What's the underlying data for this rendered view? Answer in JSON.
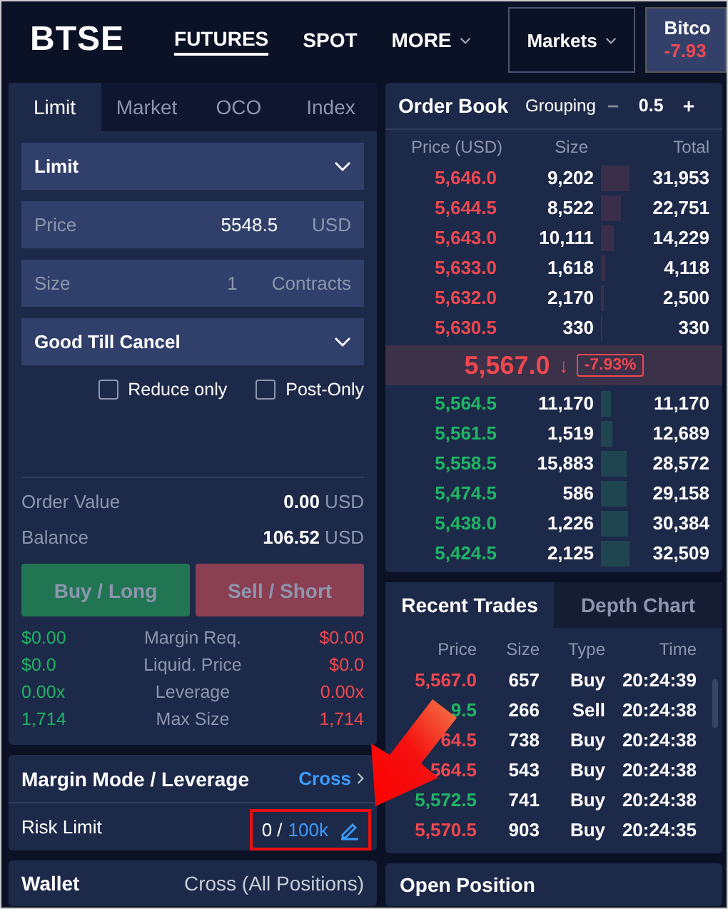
{
  "header": {
    "logo": "BTSE",
    "nav": [
      {
        "label": "FUTURES",
        "selected": true,
        "dropdown": false
      },
      {
        "label": "SPOT",
        "selected": false,
        "dropdown": false
      },
      {
        "label": "MORE",
        "selected": false,
        "dropdown": true
      }
    ],
    "markets_button": "Markets",
    "ticker": {
      "name": "Bitco",
      "change": "-7.93"
    }
  },
  "order_form": {
    "tabs": [
      {
        "label": "Limit",
        "selected": true
      },
      {
        "label": "Market",
        "selected": false
      },
      {
        "label": "OCO",
        "selected": false
      },
      {
        "label": "Index",
        "selected": false
      }
    ],
    "order_type": "Limit",
    "price": {
      "label": "Price",
      "value": "5548.5",
      "unit": "USD"
    },
    "size": {
      "label": "Size",
      "value": "1",
      "unit": "Contracts"
    },
    "time_in_force": "Good Till Cancel",
    "options": [
      {
        "label": "Reduce only",
        "checked": false
      },
      {
        "label": "Post-Only",
        "checked": false
      }
    ],
    "summary": [
      {
        "label": "Order Value",
        "value": "0.00",
        "unit": "USD"
      },
      {
        "label": "Balance",
        "value": "106.52",
        "unit": "USD"
      }
    ],
    "buy_button": "Buy / Long",
    "sell_button": "Sell / Short",
    "stats": [
      {
        "buy": "$0.00",
        "label": "Margin Req.",
        "sell": "$0.00"
      },
      {
        "buy": "$0.0",
        "label": "Liquid. Price",
        "sell": "$0.0"
      },
      {
        "buy": "0.00x",
        "label": "Leverage",
        "sell": "0.00x"
      },
      {
        "buy": "1,714",
        "label": "Max Size",
        "sell": "1,714"
      }
    ]
  },
  "margin": {
    "title": "Margin Mode / Leverage",
    "mode": "Cross",
    "risk_label": "Risk Limit",
    "risk_used": "0 /",
    "risk_max": "100k"
  },
  "wallet": {
    "title": "Wallet",
    "mode": "Cross (All Positions)"
  },
  "order_book": {
    "title": "Order Book",
    "grouping_label": "Grouping",
    "grouping": "0.5",
    "columns": [
      "Price (USD)",
      "Size",
      "Total"
    ],
    "asks": [
      {
        "price": "5,646.0",
        "size": "9,202",
        "total": "31,953"
      },
      {
        "price": "5,644.5",
        "size": "8,522",
        "total": "22,751"
      },
      {
        "price": "5,643.0",
        "size": "10,111",
        "total": "14,229"
      },
      {
        "price": "5,633.0",
        "size": "1,618",
        "total": "4,118"
      },
      {
        "price": "5,632.0",
        "size": "2,170",
        "total": "2,500"
      },
      {
        "price": "5,630.5",
        "size": "330",
        "total": "330"
      }
    ],
    "last_price": "5,567.0",
    "arrow": "↓",
    "change": "-7.93%",
    "bids": [
      {
        "price": "5,564.5",
        "size": "11,170",
        "total": "11,170"
      },
      {
        "price": "5,561.5",
        "size": "1,519",
        "total": "12,689"
      },
      {
        "price": "5,558.5",
        "size": "15,883",
        "total": "28,572"
      },
      {
        "price": "5,474.5",
        "size": "586",
        "total": "29,158"
      },
      {
        "price": "5,438.0",
        "size": "1,226",
        "total": "30,384"
      },
      {
        "price": "5,424.5",
        "size": "2,125",
        "total": "32,509"
      }
    ]
  },
  "trades": {
    "tabs": [
      {
        "label": "Recent Trades",
        "selected": true
      },
      {
        "label": "Depth Chart",
        "selected": false
      }
    ],
    "columns": [
      "Price",
      "Size",
      "Type",
      "Time"
    ],
    "rows": [
      {
        "price": "5,567.0",
        "color": "#f0474f",
        "size": "657",
        "type": "Buy",
        "time": "20:24:39"
      },
      {
        "price": "9.5",
        "color": "#1fb565",
        "size": "266",
        "type": "Sell",
        "time": "20:24:38"
      },
      {
        "price": "64.5",
        "color": "#f0474f",
        "size": "738",
        "type": "Buy",
        "time": "20:24:38"
      },
      {
        "price": "564.5",
        "color": "#f0474f",
        "size": "543",
        "type": "Buy",
        "time": "20:24:38"
      },
      {
        "price": "5,572.5",
        "color": "#1fb565",
        "size": "741",
        "type": "Buy",
        "time": "20:24:38"
      },
      {
        "price": "5,570.5",
        "color": "#f0474f",
        "size": "903",
        "type": "Buy",
        "time": "20:24:35"
      }
    ]
  },
  "open_position": {
    "title": "Open Position"
  }
}
